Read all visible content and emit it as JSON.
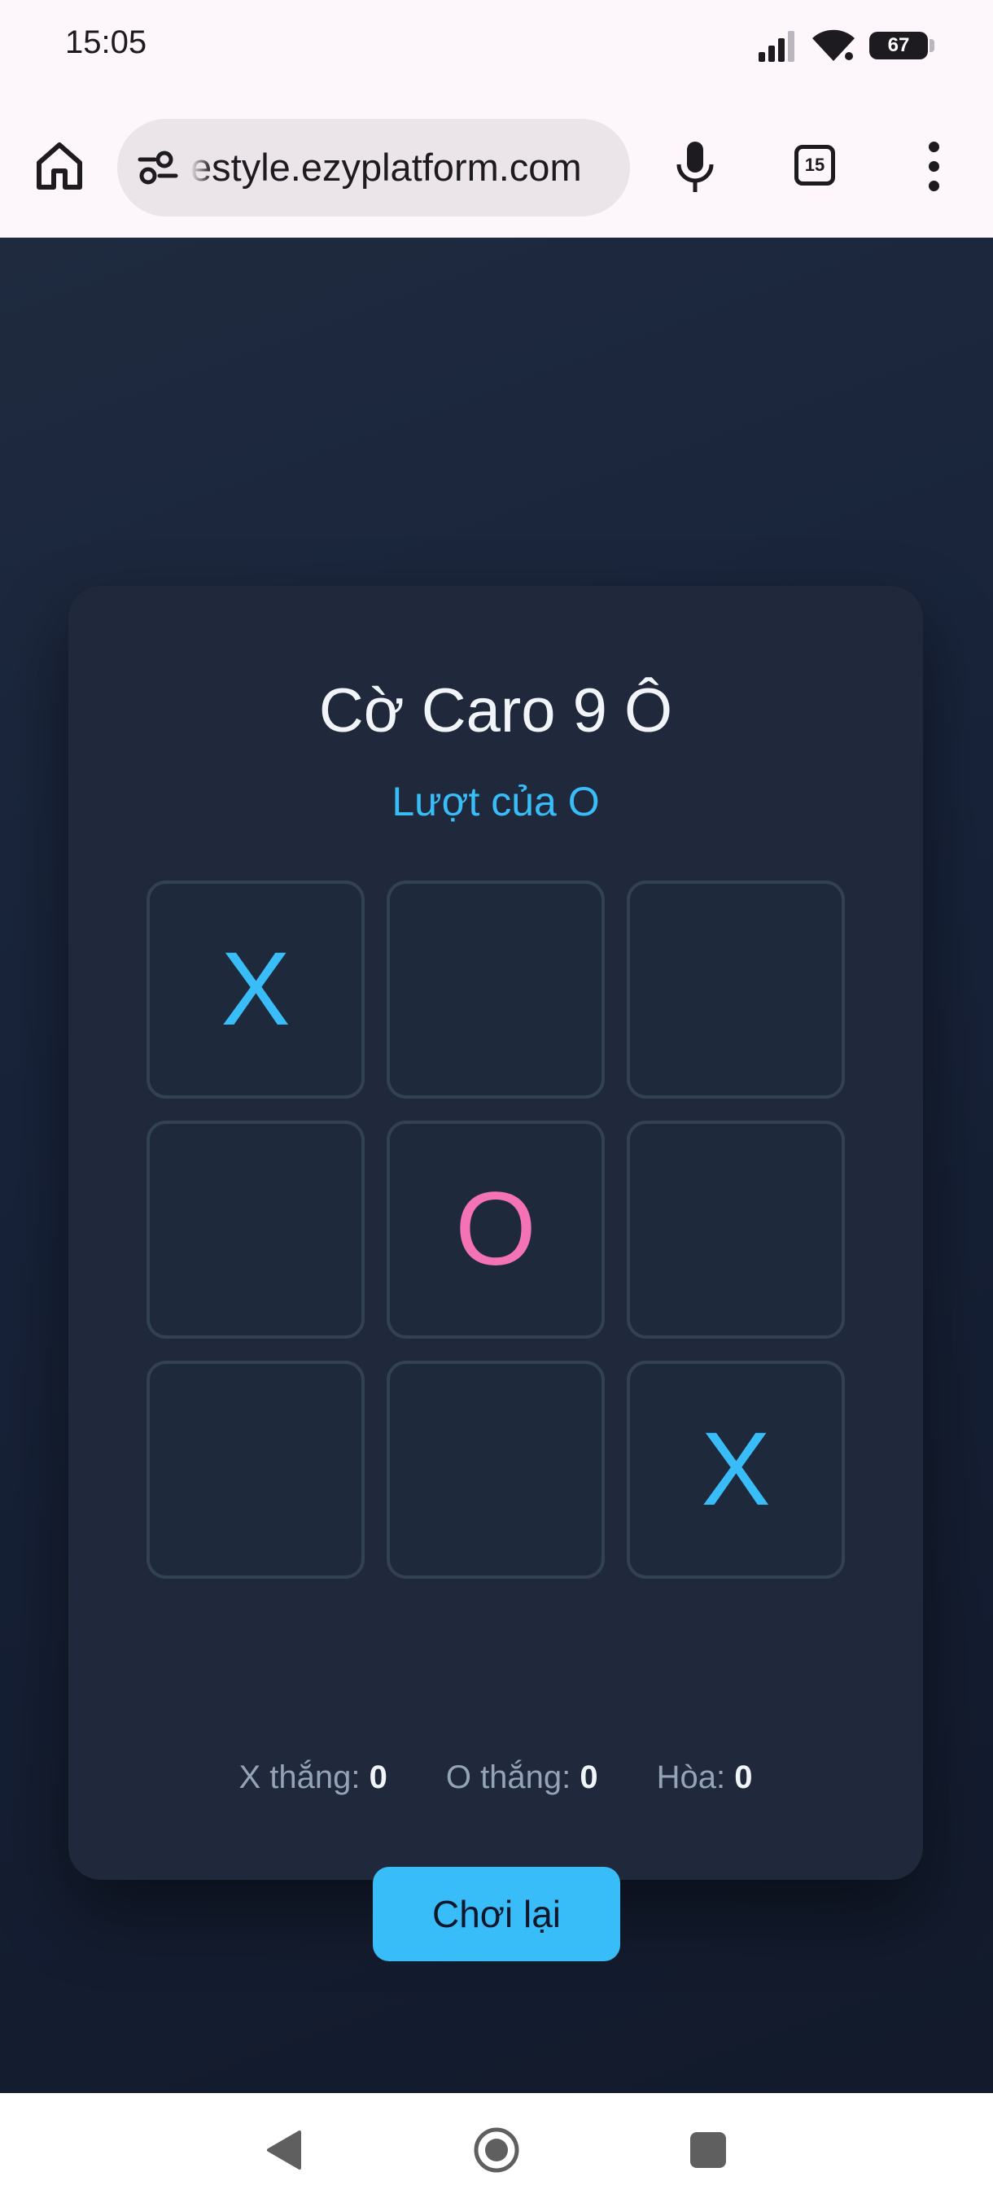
{
  "status_bar": {
    "time": "15:05",
    "battery": "67"
  },
  "browser": {
    "url": "estyle.ezyplatform.com",
    "tab_count": "15"
  },
  "game": {
    "title": "Cờ Caro 9 Ô",
    "turn": "Lượt của O",
    "board": [
      "X",
      "",
      "",
      "",
      "O",
      "",
      "",
      "",
      "X"
    ],
    "reset_label": "Chơi lại",
    "scores": {
      "x_label": "X thắng:",
      "x_value": "0",
      "o_label": "O thắng:",
      "o_value": "0",
      "draw_label": "Hòa:",
      "draw_value": "0"
    }
  },
  "colors": {
    "accent": "#38bdf8",
    "x_mark": "#38bdf8",
    "o_mark": "#f472b6",
    "card": "#1f293b"
  }
}
